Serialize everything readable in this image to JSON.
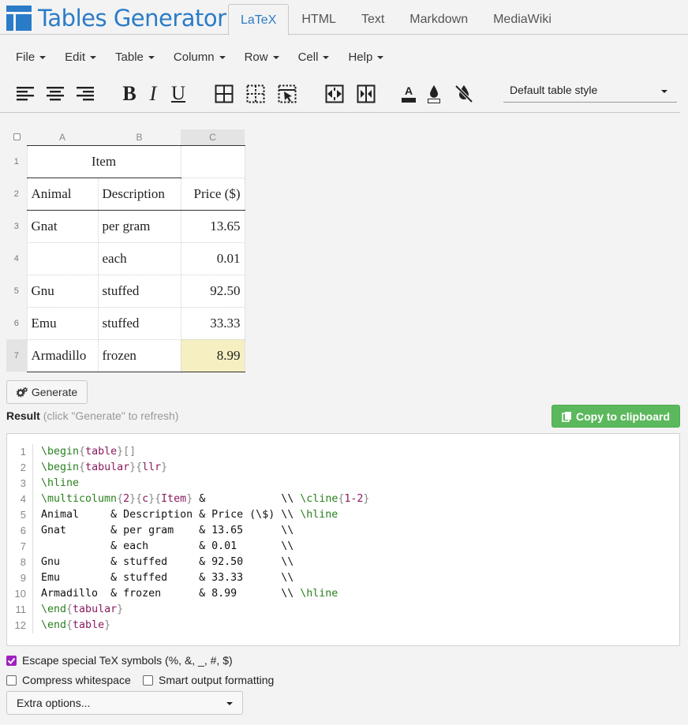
{
  "app": {
    "title": "Tables Generator"
  },
  "tabs": [
    {
      "label": "LaTeX",
      "active": true
    },
    {
      "label": "HTML"
    },
    {
      "label": "Text"
    },
    {
      "label": "Markdown"
    },
    {
      "label": "MediaWiki"
    }
  ],
  "menu": [
    "File",
    "Edit",
    "Table",
    "Column",
    "Row",
    "Cell",
    "Help"
  ],
  "toolbar": {
    "icons": [
      "align-left-icon",
      "align-center-icon",
      "align-right-icon",
      "bold-icon",
      "italic-icon",
      "underline-icon",
      "all-borders-icon",
      "no-borders-icon",
      "clear-borders-icon",
      "merge-cells-icon",
      "split-cells-icon",
      "text-color-icon",
      "background-color-icon",
      "clear-formatting-icon"
    ],
    "bold": "B",
    "italic": "I",
    "underline": "U",
    "text_color_glyph": "A",
    "style_select": "Default table style"
  },
  "grid": {
    "columns": [
      "A",
      "B",
      "C"
    ],
    "rows": [
      {
        "n": "1",
        "cells": [
          "Item",
          "",
          ""
        ]
      },
      {
        "n": "2",
        "cells": [
          "Animal",
          "Description",
          "Price ($)"
        ]
      },
      {
        "n": "3",
        "cells": [
          "Gnat",
          "per gram",
          "13.65"
        ]
      },
      {
        "n": "4",
        "cells": [
          "",
          "each",
          "0.01"
        ]
      },
      {
        "n": "5",
        "cells": [
          "Gnu",
          "stuffed",
          "92.50"
        ]
      },
      {
        "n": "6",
        "cells": [
          "Emu",
          "stuffed",
          "33.33"
        ]
      },
      {
        "n": "7",
        "cells": [
          "Armadillo",
          "frozen",
          "8.99"
        ]
      }
    ]
  },
  "generate": {
    "label": "Generate"
  },
  "result": {
    "label": "Result",
    "hint": "(click \"Generate\" to refresh)"
  },
  "copy": {
    "label": "Copy to clipboard"
  },
  "code": {
    "line_numbers": [
      "1",
      "2",
      "3",
      "4",
      "5",
      "6",
      "7",
      "8",
      "9",
      "10",
      "11",
      "12"
    ],
    "lines": [
      "\\begin{table}[]",
      "\\begin{tabular}{llr}",
      "\\hline",
      "\\multicolumn{2}{c}{Item} &            \\\\ \\cline{1-2}",
      "Animal     & Description & Price (\\$) \\\\ \\hline",
      "Gnat       & per gram    & 13.65      \\\\",
      "           & each        & 0.01       \\\\",
      "Gnu        & stuffed     & 92.50      \\\\",
      "Emu        & stuffed     & 33.33      \\\\",
      "Armadillo  & frozen      & 8.99       \\\\ \\hline",
      "\\end{tabular}",
      "\\end{table}"
    ]
  },
  "options": {
    "escape": {
      "label": "Escape special TeX symbols (%, &, _, #, $)",
      "checked": true
    },
    "compress": {
      "label": "Compress whitespace",
      "checked": false
    },
    "smart": {
      "label": "Smart output formatting",
      "checked": false
    }
  },
  "extra": {
    "label": "Extra options..."
  },
  "colors": {
    "accent": "#2a7cc8",
    "copy_button": "#5cb85c",
    "highlight_cell": "#f5efc2",
    "checkbox_on": "#a020c0"
  }
}
